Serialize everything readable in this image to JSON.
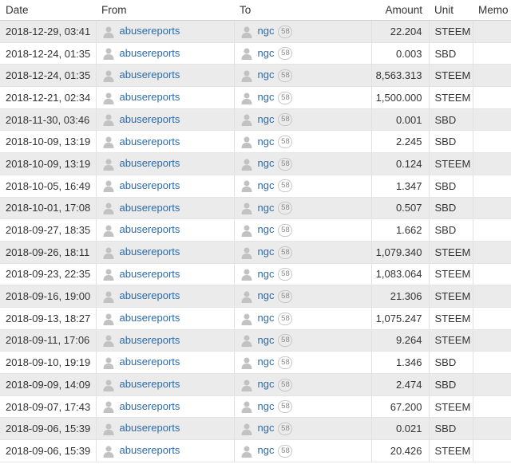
{
  "table": {
    "headers": {
      "date": "Date",
      "from": "From",
      "to": "To",
      "amount": "Amount",
      "unit": "Unit",
      "memo": "Memo"
    },
    "rows": [
      {
        "date": "2018-12-29, 03:41",
        "from": "abusereports",
        "to": "ngc",
        "to_rep": "58",
        "amount": "22.204",
        "unit": "STEEM",
        "memo": ""
      },
      {
        "date": "2018-12-24, 01:35",
        "from": "abusereports",
        "to": "ngc",
        "to_rep": "58",
        "amount": "0.003",
        "unit": "SBD",
        "memo": ""
      },
      {
        "date": "2018-12-24, 01:35",
        "from": "abusereports",
        "to": "ngc",
        "to_rep": "58",
        "amount": "8,563.313",
        "unit": "STEEM",
        "memo": ""
      },
      {
        "date": "2018-12-21, 02:34",
        "from": "abusereports",
        "to": "ngc",
        "to_rep": "58",
        "amount": "1,500.000",
        "unit": "STEEM",
        "memo": ""
      },
      {
        "date": "2018-11-30, 03:46",
        "from": "abusereports",
        "to": "ngc",
        "to_rep": "58",
        "amount": "0.001",
        "unit": "SBD",
        "memo": ""
      },
      {
        "date": "2018-10-09, 13:19",
        "from": "abusereports",
        "to": "ngc",
        "to_rep": "58",
        "amount": "2.245",
        "unit": "SBD",
        "memo": ""
      },
      {
        "date": "2018-10-09, 13:19",
        "from": "abusereports",
        "to": "ngc",
        "to_rep": "58",
        "amount": "0.124",
        "unit": "STEEM",
        "memo": ""
      },
      {
        "date": "2018-10-05, 16:49",
        "from": "abusereports",
        "to": "ngc",
        "to_rep": "58",
        "amount": "1.347",
        "unit": "SBD",
        "memo": ""
      },
      {
        "date": "2018-10-01, 17:08",
        "from": "abusereports",
        "to": "ngc",
        "to_rep": "58",
        "amount": "0.507",
        "unit": "SBD",
        "memo": ""
      },
      {
        "date": "2018-09-27, 18:35",
        "from": "abusereports",
        "to": "ngc",
        "to_rep": "58",
        "amount": "1.662",
        "unit": "SBD",
        "memo": ""
      },
      {
        "date": "2018-09-26, 18:11",
        "from": "abusereports",
        "to": "ngc",
        "to_rep": "58",
        "amount": "1,079.340",
        "unit": "STEEM",
        "memo": ""
      },
      {
        "date": "2018-09-23, 22:35",
        "from": "abusereports",
        "to": "ngc",
        "to_rep": "58",
        "amount": "1,083.064",
        "unit": "STEEM",
        "memo": ""
      },
      {
        "date": "2018-09-16, 19:00",
        "from": "abusereports",
        "to": "ngc",
        "to_rep": "58",
        "amount": "21.306",
        "unit": "STEEM",
        "memo": ""
      },
      {
        "date": "2018-09-13, 18:27",
        "from": "abusereports",
        "to": "ngc",
        "to_rep": "58",
        "amount": "1,075.247",
        "unit": "STEEM",
        "memo": ""
      },
      {
        "date": "2018-09-11, 17:06",
        "from": "abusereports",
        "to": "ngc",
        "to_rep": "58",
        "amount": "9.264",
        "unit": "STEEM",
        "memo": ""
      },
      {
        "date": "2018-09-10, 19:19",
        "from": "abusereports",
        "to": "ngc",
        "to_rep": "58",
        "amount": "1.346",
        "unit": "SBD",
        "memo": ""
      },
      {
        "date": "2018-09-09, 14:09",
        "from": "abusereports",
        "to": "ngc",
        "to_rep": "58",
        "amount": "2.474",
        "unit": "SBD",
        "memo": ""
      },
      {
        "date": "2018-09-07, 17:43",
        "from": "abusereports",
        "to": "ngc",
        "to_rep": "58",
        "amount": "67.200",
        "unit": "STEEM",
        "memo": ""
      },
      {
        "date": "2018-09-06, 15:39",
        "from": "abusereports",
        "to": "ngc",
        "to_rep": "58",
        "amount": "0.021",
        "unit": "SBD",
        "memo": ""
      },
      {
        "date": "2018-09-06, 15:39",
        "from": "abusereports",
        "to": "ngc",
        "to_rep": "58",
        "amount": "20.426",
        "unit": "STEEM",
        "memo": ""
      }
    ]
  },
  "icons": {
    "user": "user-avatar-icon"
  },
  "colors": {
    "link": "#2e6aa7",
    "row_odd": "#ebebeb",
    "row_even": "#ffffff",
    "icon_gray": "#c2c2c2"
  }
}
